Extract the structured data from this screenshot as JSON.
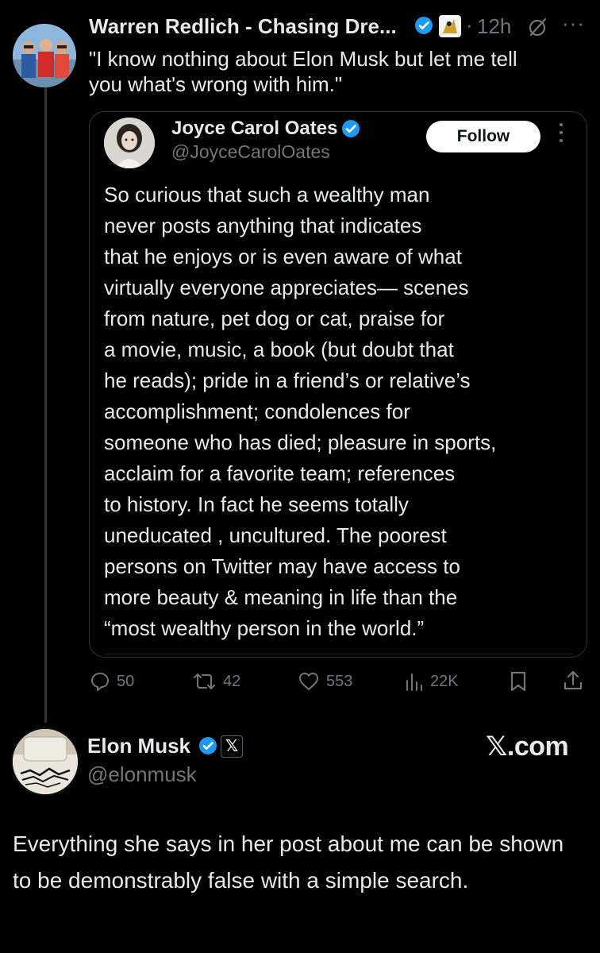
{
  "colors": {
    "background": "#000000",
    "text": "#e7e9ea",
    "muted": "#71767b",
    "verified": "#1d9bf0",
    "border": "#2f3336"
  },
  "post": {
    "author_name": "Warren Redlich - Chasing Dre...",
    "time": "12h",
    "separator": "·",
    "more": "···",
    "text": "\"I know nothing about Elon Musk but let me tell\nyou what's wrong with him.\"",
    "icons": [
      "verified-badge-icon",
      "affiliate-badge-icon",
      "grok-icon",
      "more-icon"
    ]
  },
  "quote": {
    "author_name": "Joyce Carol Oates",
    "handle": "@JoyceCarolOates",
    "follow_label": "Follow",
    "lines": [
      "So curious that such a wealthy man",
      "never posts anything that indicates",
      "that he enjoys or is even aware of what",
      "virtually everyone appreciates— scenes",
      "from nature, pet dog or cat, praise for",
      "a movie, music, a book (but doubt that",
      "he reads); pride in a friend’s or relative’s",
      "accomplishment; condolences for",
      "someone who has died; pleasure in sports,",
      "acclaim for a favorite team;  references",
      "to history.  In fact he seems totally",
      "uneducated , uncultured. The poorest",
      "persons on Twitter may have access to",
      "more beauty & meaning in life than the",
      "“most wealthy person in the world.”"
    ]
  },
  "actions": {
    "replies": "50",
    "reposts": "42",
    "likes": "553",
    "views": "22K"
  },
  "reply": {
    "author_name": "Elon Musk",
    "handle": "@elonmusk",
    "affiliate_label": "𝕏",
    "brand": "𝕏.com",
    "text": "Everything she says in her post about me can be shown to be demonstrably false with a simple search."
  }
}
